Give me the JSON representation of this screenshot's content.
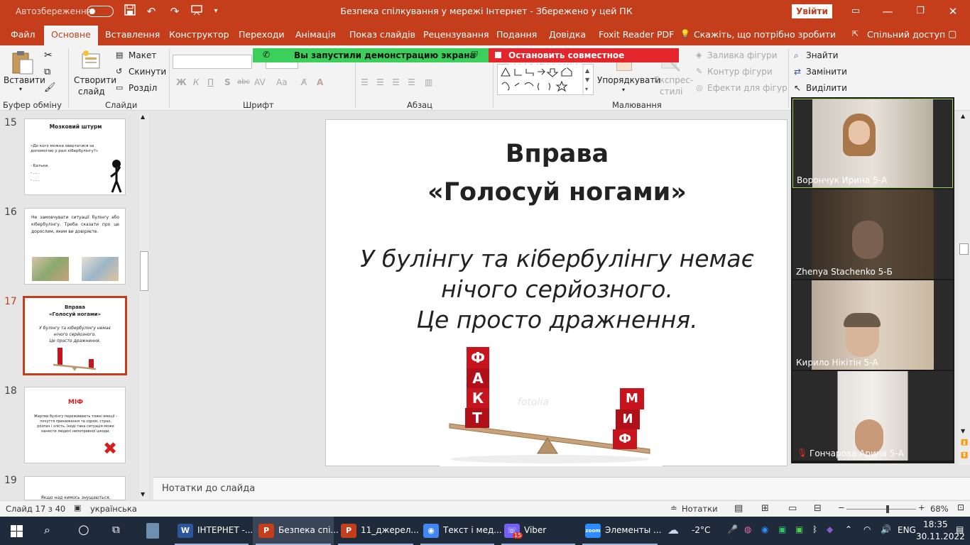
{
  "titlebar": {
    "autosave_label": "Автозбереження",
    "autosave_state": "off",
    "document_title": "Безпека спілкування у мережі Інтернет  -  Збережено у цей ПК",
    "signin_label": "Увійти",
    "icons": [
      "save-icon",
      "undo-icon",
      "redo-icon",
      "slideshow-icon",
      "customize-icon",
      "ribbon-display-icon",
      "minimize-icon",
      "restore-icon",
      "close-icon"
    ]
  },
  "tabs": [
    {
      "label": "Файл"
    },
    {
      "label": "Основне",
      "active": true
    },
    {
      "label": "Вставлення"
    },
    {
      "label": "Конструктор"
    },
    {
      "label": "Переходи"
    },
    {
      "label": "Анімація"
    },
    {
      "label": "Показ слайдів"
    },
    {
      "label": "Рецензування"
    },
    {
      "label": "Подання"
    },
    {
      "label": "Довідка"
    },
    {
      "label": "Foxit Reader PDF"
    }
  ],
  "tell_me": "Скажіть, що потрібно зробити",
  "share": "Спільний доступ",
  "ribbon": {
    "clipboard": {
      "paste": "Вставити",
      "group": "Буфер обміну"
    },
    "slides": {
      "new_slide_line1": "Створити",
      "new_slide_line2": "слайд",
      "layout": "Макет",
      "reset": "Скинути",
      "section": "Розділ",
      "group": "Слайди"
    },
    "font": {
      "group": "Шрифт",
      "bold": "Ж",
      "italic": "К",
      "underline": "П",
      "shadow": "S",
      "strike": "abc",
      "spacing": "AV",
      "case": "Aa"
    },
    "paragraph": {
      "group": "Абзац"
    },
    "drawing": {
      "arrange": "Упорядкувати",
      "quick_styles_line1": "Експрес-",
      "quick_styles_line2": "стилі",
      "shape_fill": "Заливка фігури",
      "shape_outline": "Контур фігури",
      "shape_effects": "Ефекти для фігур",
      "group": "Малювання"
    },
    "editing": {
      "find": "Знайти",
      "replace": "Замінити",
      "select": "Виділити"
    }
  },
  "banners": {
    "sharing": "Вы запустили демонстрацию экрана",
    "stop": "Остановить совместное использование"
  },
  "thumbnails": [
    {
      "num": "15",
      "title": "Мозковий штурм",
      "text": "«До кого можна звертатися     за допомогою у разі кібербулінгу?»",
      "items": [
        "- Батьки.",
        "- … .",
        "- … ."
      ]
    },
    {
      "num": "16",
      "text": "Не замовчувати ситуації булінгу або кібербулінгу. Треба сказати про це дорослим, яким ви довіряєте."
    },
    {
      "num": "17",
      "title1": "Вправа",
      "title2": "«Голосуй ногами»",
      "text1": "У булінгу та кібербулінгу немає",
      "text2": "нічого серйозного.",
      "text3": "Це просто дражнення.",
      "selected": true
    },
    {
      "num": "18",
      "title": "МІФ",
      "text": "Жертви булінгу переживають тяжкі емоції – почуття приниження та сором, страх, розпач і злість. Іноді така ситуація може нанести людині непоправної шкоди."
    },
    {
      "num": "19",
      "text": "Якщо над кимось знущаються,"
    }
  ],
  "slide": {
    "title_line1": "Вправа",
    "title_line2": "«Голосуй ногами»",
    "body_line1": "У булінгу та кібербулінгу немає",
    "body_line2": "нічого серйозного.",
    "body_line3": "Це просто дражнення.",
    "left_cubes": [
      "Ф",
      "А",
      "К",
      "Т"
    ],
    "right_cubes": [
      "М",
      "И",
      "Ф"
    ],
    "watermark": "fotolia"
  },
  "notes_placeholder": "Нотатки до слайда",
  "video": {
    "participants": [
      {
        "name": "Ворончук Ирина 5-А",
        "speaking": true
      },
      {
        "name": "Zhenya Stachenko 5-Б"
      },
      {
        "name": "Кирило Нікітін 5-А"
      },
      {
        "name": "Гончарова Арина 5-А",
        "muted": true
      }
    ]
  },
  "statusbar": {
    "slide_info": "Слайд 17 з 40",
    "language": "українська",
    "notes": "Нотатки",
    "zoom": "68%",
    "zoom_fraction": 0.68
  },
  "taskbar": {
    "apps": [
      {
        "label": "ІНТЕРНЕТ -...",
        "icon": "W",
        "color": "#2b579a"
      },
      {
        "label": "Безпека спі...",
        "icon": "P",
        "color": "#c43e1c",
        "active": true
      },
      {
        "label": "11_джерел...",
        "icon": "P",
        "color": "#c43e1c"
      },
      {
        "label": "Текст і мед...",
        "icon": "◉",
        "color": "#4285f4"
      },
      {
        "label": "Viber",
        "icon": "☏",
        "color": "#7360f2",
        "badge": "15"
      },
      {
        "label": "Элементы ...",
        "icon": "zoom",
        "color": "#2d8cff"
      }
    ],
    "weather": "-2°C",
    "language": "ENG",
    "time": "18:35",
    "date": "30.11.2022"
  }
}
